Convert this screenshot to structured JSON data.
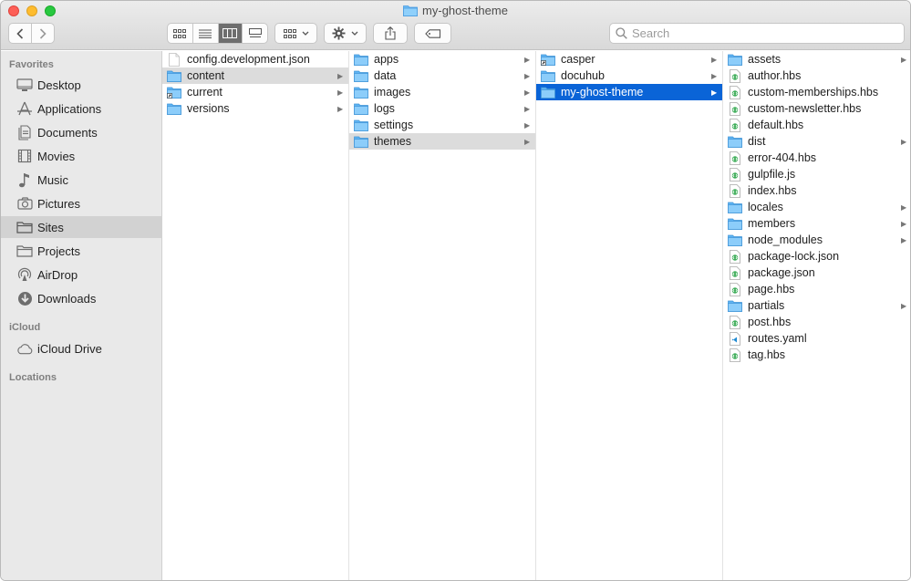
{
  "window": {
    "title": "my-ghost-theme"
  },
  "toolbar": {
    "back_icon": "chevron-left-icon",
    "forward_icon": "chevron-right-icon",
    "view_modes": [
      "icon-view-icon",
      "list-view-icon",
      "column-view-icon",
      "gallery-view-icon"
    ],
    "active_view": "column-view-icon",
    "search_placeholder": "Search"
  },
  "sidebar": {
    "sections": [
      {
        "title": "Favorites",
        "items": [
          {
            "label": "Desktop",
            "icon": "desktop-icon"
          },
          {
            "label": "Applications",
            "icon": "applications-icon"
          },
          {
            "label": "Documents",
            "icon": "documents-icon"
          },
          {
            "label": "Movies",
            "icon": "movies-icon"
          },
          {
            "label": "Music",
            "icon": "music-icon"
          },
          {
            "label": "Pictures",
            "icon": "pictures-icon"
          },
          {
            "label": "Sites",
            "icon": "sites-folder-icon",
            "selected": true
          },
          {
            "label": "Projects",
            "icon": "folder-icon"
          },
          {
            "label": "AirDrop",
            "icon": "airdrop-icon"
          },
          {
            "label": "Downloads",
            "icon": "downloads-icon"
          }
        ]
      },
      {
        "title": "iCloud",
        "items": [
          {
            "label": "iCloud Drive",
            "icon": "cloud-icon"
          }
        ]
      },
      {
        "title": "Locations",
        "items": []
      }
    ]
  },
  "columns": [
    {
      "items": [
        {
          "label": "config.development.json",
          "kind": "file"
        },
        {
          "label": "content",
          "kind": "folder",
          "selected": "gray"
        },
        {
          "label": "current",
          "kind": "alias"
        },
        {
          "label": "versions",
          "kind": "folder"
        }
      ]
    },
    {
      "items": [
        {
          "label": "apps",
          "kind": "folder"
        },
        {
          "label": "data",
          "kind": "folder"
        },
        {
          "label": "images",
          "kind": "folder"
        },
        {
          "label": "logs",
          "kind": "folder"
        },
        {
          "label": "settings",
          "kind": "folder"
        },
        {
          "label": "themes",
          "kind": "folder",
          "selected": "gray"
        }
      ]
    },
    {
      "items": [
        {
          "label": "casper",
          "kind": "alias"
        },
        {
          "label": "docuhub",
          "kind": "folder"
        },
        {
          "label": "my-ghost-theme",
          "kind": "folder",
          "selected": "blue"
        }
      ]
    },
    {
      "items": [
        {
          "label": "assets",
          "kind": "folder"
        },
        {
          "label": "author.hbs",
          "kind": "code"
        },
        {
          "label": "custom-memberships.hbs",
          "kind": "code"
        },
        {
          "label": "custom-newsletter.hbs",
          "kind": "code"
        },
        {
          "label": "default.hbs",
          "kind": "code"
        },
        {
          "label": "dist",
          "kind": "folder"
        },
        {
          "label": "error-404.hbs",
          "kind": "code"
        },
        {
          "label": "gulpfile.js",
          "kind": "code"
        },
        {
          "label": "index.hbs",
          "kind": "code"
        },
        {
          "label": "locales",
          "kind": "folder"
        },
        {
          "label": "members",
          "kind": "folder"
        },
        {
          "label": "node_modules",
          "kind": "folder"
        },
        {
          "label": "package-lock.json",
          "kind": "code"
        },
        {
          "label": "package.json",
          "kind": "code"
        },
        {
          "label": "page.hbs",
          "kind": "code"
        },
        {
          "label": "partials",
          "kind": "folder"
        },
        {
          "label": "post.hbs",
          "kind": "code"
        },
        {
          "label": "routes.yaml",
          "kind": "vscode"
        },
        {
          "label": "tag.hbs",
          "kind": "code"
        }
      ]
    }
  ],
  "colors": {
    "selection_blue": "#0a64d7",
    "selection_gray": "#dcdcdc",
    "folder_blue": "#5fb4f3"
  }
}
